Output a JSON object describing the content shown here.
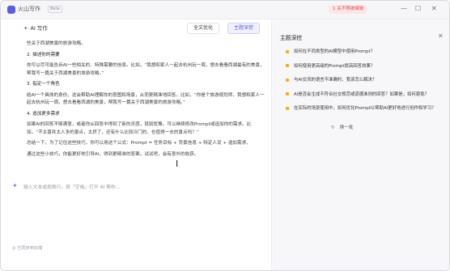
{
  "titlebar": {
    "app_name": "火山写作",
    "beta": "Beta",
    "promo": "1 关不限被编辑",
    "min_glyph": "—",
    "max_glyph": "☐",
    "close_glyph": "✕"
  },
  "toolbar": {
    "ai_write_icon": "✦",
    "ai_write_label": "AI 写作",
    "polish_label": "全文优化",
    "deep_label": "主题深挖"
  },
  "document": {
    "paragraphs": [
      {
        "text": "些关于西湖美景的旅游攻略。",
        "head": false
      },
      {
        "text": "2. 描述你的需要",
        "head": true
      },
      {
        "text": "你可以尽可能告诉AI一些相关的、特殊需要的信息。比如，“我想和家人一起去杭州玩一周，想去看看西湖最有的美景，帮我写一篇关于西湖美景的旅游攻略。”",
        "head": false
      },
      {
        "text": "3. 指定一个角色",
        "head": true
      },
      {
        "text": "给AI一个具体的身份，这会帮助AI理解你的意图和场景，从而更精准地回答。比如，“你是个旅游规划师，我想和家人一起去杭州玩一周，想去看看西湖的美景，帮我写一篇关于西湖美景的旅游攻略。”",
        "head": false
      },
      {
        "text": "4. 追加更多需求",
        "head": true
      },
      {
        "text": "如果AI的回答不够满意，或者你从回答中得到了新的灵感，就别犹豫，可以继续修改Prompt或追加你的需求。比如，“不太喜欢太人多的景点，太挤了，还有什么比较冷门的、也值得一去的景点吗？”",
        "head": false
      },
      {
        "text": "总结一下，为了记住这些技巧，你可以用这个公式：Prompt = 任务目标 + 背景信息 + 特定人设 + 追加需求。",
        "head": false
      },
      {
        "text": "通过这些小技巧，你能更好地引导AI，得到更精准的答案。试试吧，会有意外的收获。",
        "head": false
      }
    ],
    "cursor_glyph": "I"
  },
  "input": {
    "sparkle_icon": "✦",
    "placeholder": "输入文本或按换行，按「空格」打开 AI 帮你..."
  },
  "footer": {
    "status": "◎ 已同步到云端"
  },
  "panel": {
    "title": "主题深挖",
    "close_glyph": "✕",
    "questions": [
      "如何在不同类型的AI模型中使用Prompt？",
      "如何使用更高级的Prompt提高回答效果？",
      "与AI交流的语言不准确时，我该怎么解决？",
      "AI是否会生成不符合社交规范或道德准则的回答？如果是，如何避免？",
      "在实际的场景使用中，如何优化Prompt以帮助AI更好地进行创作和学习？"
    ],
    "refresh_icon": "↻",
    "refresh_label": "换一批"
  },
  "colors": {
    "accent": "#5b5ce6",
    "question_marker": "#f2b01e",
    "promo_bg": "#fde6e6"
  }
}
